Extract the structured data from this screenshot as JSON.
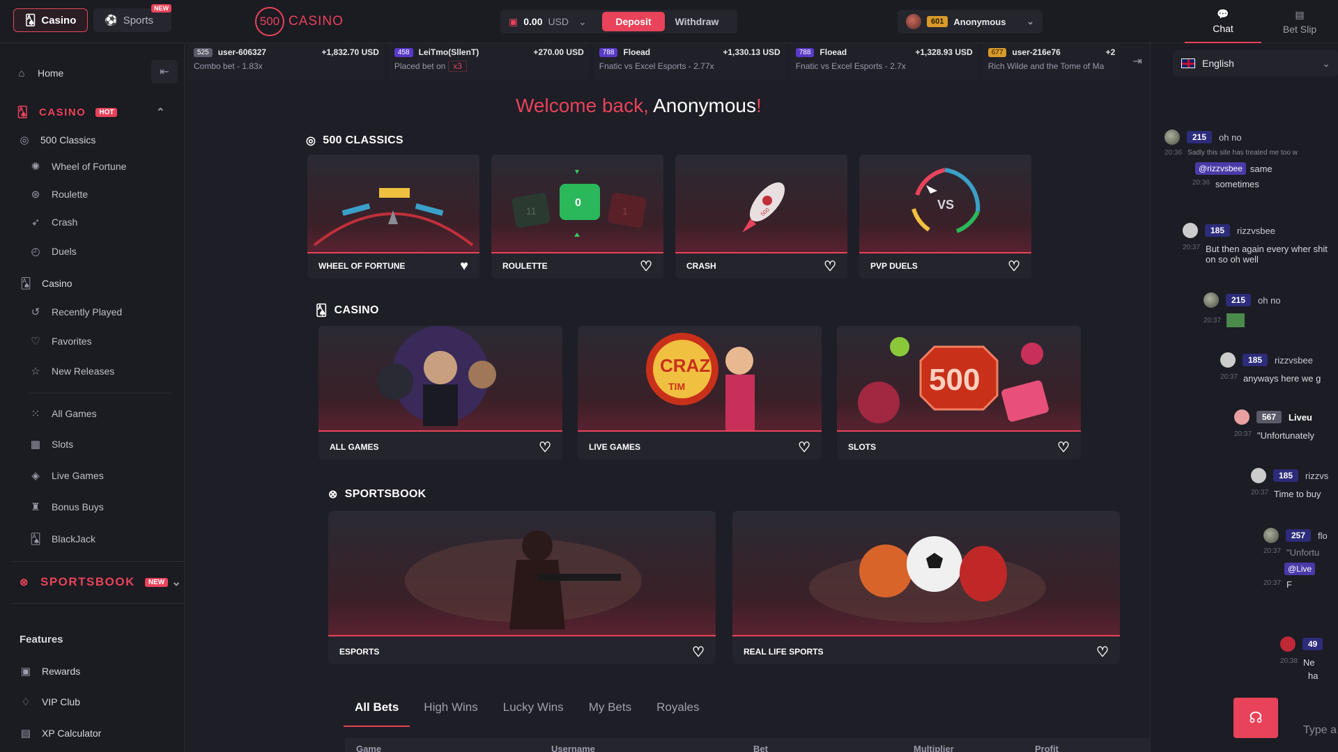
{
  "topbar": {
    "casino_label": "Casino",
    "sports_label": "Sports",
    "sports_new": "NEW",
    "logo_num": "500",
    "logo_text": "CASINO",
    "balance": "0.00",
    "currency": "USD",
    "deposit": "Deposit",
    "withdraw": "Withdraw",
    "user_level": "601",
    "username": "Anonymous",
    "tab_chat": "Chat",
    "tab_betslip": "Bet Slip"
  },
  "sidebar": {
    "home": "Home",
    "casino_head": "CASINO",
    "casino_hot": "HOT",
    "classics": "500 Classics",
    "wheel": "Wheel of Fortune",
    "roulette": "Roulette",
    "crash": "Crash",
    "duels": "Duels",
    "casino": "Casino",
    "recent": "Recently Played",
    "favorites": "Favorites",
    "new_releases": "New Releases",
    "all_games": "All Games",
    "slots": "Slots",
    "live_games": "Live Games",
    "bonus_buys": "Bonus Buys",
    "blackjack": "BlackJack",
    "sportsbook_head": "SPORTSBOOK",
    "sportsbook_new": "NEW",
    "features": "Features",
    "rewards": "Rewards",
    "vip": "VIP Club",
    "xp": "XP Calculator"
  },
  "ticker": [
    {
      "lvl": "525",
      "user": "user-606327",
      "amount": "+1,832.70 USD",
      "sub": "Combo bet - 1.83x",
      "mult": ""
    },
    {
      "lvl": "458",
      "user": "LeiTmo(SllenT)",
      "amount": "+270.00 USD",
      "sub": "Placed bet on",
      "mult": "x3"
    },
    {
      "lvl": "788",
      "user": "Floead",
      "amount": "+1,330.13 USD",
      "sub": "Fnatic vs Excel Esports - 2.77x",
      "mult": ""
    },
    {
      "lvl": "788",
      "user": "Floead",
      "amount": "+1,328.93 USD",
      "sub": "Fnatic vs Excel Esports - 2.7x",
      "mult": ""
    },
    {
      "lvl": "677",
      "user": "user-216e76",
      "amount": "+2",
      "sub": "Rich Wilde and the Tome of Ma",
      "mult": ""
    }
  ],
  "main": {
    "welcome_1": "Welcome back,",
    "welcome_2": "Anonymous",
    "welcome_3": "!",
    "sec_classics": "500 CLASSICS",
    "sec_casino": "CASINO",
    "sec_sportsbook": "SPORTSBOOK",
    "classics": [
      "WHEEL OF FORTUNE",
      "ROULETTE",
      "CRASH",
      "PVP DUELS"
    ],
    "casino": [
      "ALL GAMES",
      "LIVE GAMES",
      "SLOTS"
    ],
    "sports": [
      "ESPORTS",
      "REAL LIFE SPORTS"
    ],
    "roulette_num": "0",
    "roulette_left": "11",
    "roulette_right": "1",
    "slots_num": "500",
    "crash_num": "500",
    "duel_vs": "VS",
    "live_logo": "CRAZ",
    "live_logo_2": "TIM"
  },
  "bets": {
    "tabs": [
      "All Bets",
      "High Wins",
      "Lucky Wins",
      "My Bets",
      "Royales"
    ],
    "columns": [
      "Game",
      "Username",
      "Bet",
      "Multiplier",
      "Profit"
    ]
  },
  "chat": {
    "language": "English",
    "input_placeholder": "Type a",
    "messages": [
      {
        "lvl": "215",
        "user": "oh no",
        "time": "20:36",
        "quote": "Sadly this site has treated me too w",
        "mention": "@rizzvsbee",
        "after": "same",
        "text": "sometimes"
      },
      {
        "lvl": "185",
        "user": "rizzvsbee",
        "time": "20:37",
        "text": "But then again every wher shit on so oh well"
      },
      {
        "lvl": "215",
        "user": "oh no",
        "time": "20:37"
      },
      {
        "lvl": "185",
        "user": "rizzvsbee",
        "time": "20:37",
        "text": "anyways here we g"
      },
      {
        "lvl": "567",
        "user": "Liveu",
        "time": "20:37",
        "text": "\"Unfortunately"
      },
      {
        "lvl": "185",
        "user": "rizzvs",
        "time": "20:37",
        "text": "Time to buy"
      },
      {
        "lvl": "257",
        "user": "flo",
        "time": "20:37",
        "quote": "\"Unfortu",
        "mention": "@Live",
        "text": "F"
      },
      {
        "lvl": "49",
        "user": "",
        "time": "20:38",
        "text": "Ne",
        "text2": "ha"
      }
    ]
  }
}
